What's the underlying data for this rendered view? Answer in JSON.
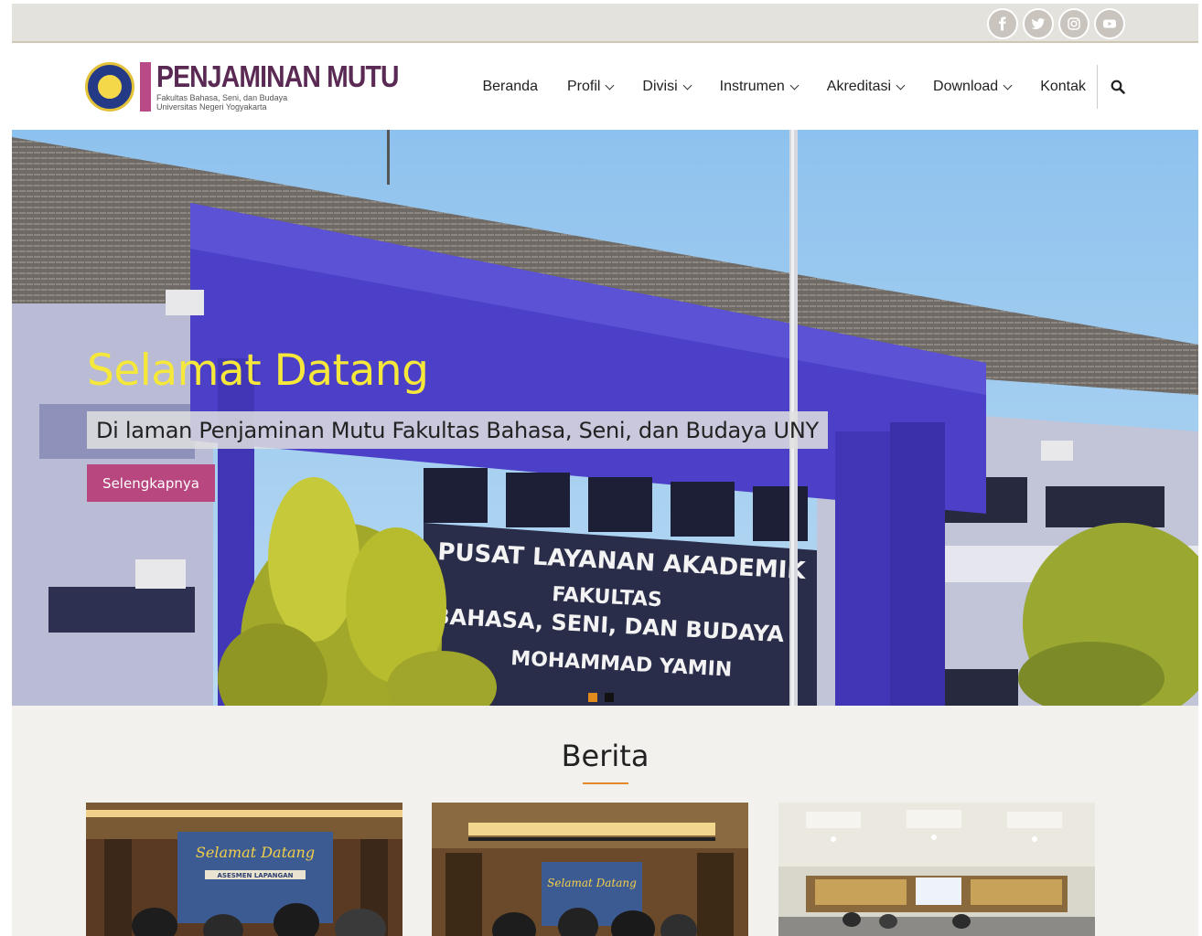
{
  "topbar": {
    "socials": [
      {
        "icon": "facebook-icon",
        "glyph": "f"
      },
      {
        "icon": "twitter-icon"
      },
      {
        "icon": "instagram-icon"
      },
      {
        "icon": "youtube-icon"
      }
    ]
  },
  "header": {
    "logo_title": "PENJAMINAN MUTU",
    "logo_sub1": "Fakultas Bahasa, Seni, dan Budaya",
    "logo_sub2": "Universitas Negeri Yogyakarta",
    "nav": {
      "beranda": "Beranda",
      "profil": "Profil",
      "divisi": "Divisi",
      "instrumen": "Instrumen",
      "akreditasi": "Akreditasi",
      "download": "Download",
      "kontak": "Kontak"
    }
  },
  "hero": {
    "title": "Selamat Datang",
    "subtitle": "Di laman Penjaminan Mutu Fakultas Bahasa, Seni, dan Budaya UNY",
    "button": "Selengkapnya",
    "sign_line1": "PUSAT LAYANAN AKADEMIK",
    "sign_line2": "FAKULTAS",
    "sign_line3": "BAHASA, SENI, DAN BUDAYA",
    "sign_line4": "MOHAMMAD YAMIN",
    "slides_total": 2,
    "active_slide": 1
  },
  "news": {
    "title": "Berita",
    "card1_banner": "Selamat Datang",
    "card1_banner2": "ASESMEN LAPANGAN",
    "card2_banner": "Selamat Datang"
  },
  "colors": {
    "accent": "#b8477f",
    "hero_title": "#f5e83a",
    "underline": "#e3892a"
  }
}
